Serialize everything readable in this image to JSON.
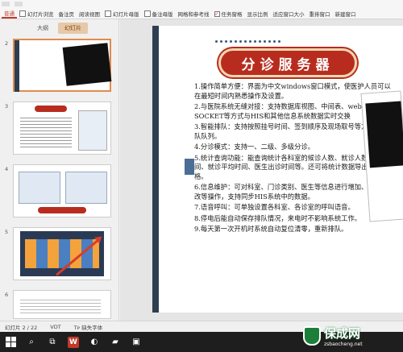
{
  "ribbon": {
    "items": [
      "普通",
      "幻灯片浏览",
      "备注页",
      "阅读视图",
      "幻灯片母版",
      "备注母版",
      "网格和参考线",
      "任务窗格",
      "显示比例",
      "适应窗口大小",
      "重排窗口",
      "新建窗口"
    ],
    "active": "普通",
    "task_pane_checked": "✓"
  },
  "left_panel": {
    "tabs": [
      "大纲",
      "幻灯片"
    ],
    "active_tab": "幻灯片",
    "slide_numbers": [
      "2",
      "3",
      "4",
      "5",
      "6"
    ]
  },
  "slide": {
    "title": "分诊服务器",
    "points": [
      "1.操作简单方便：界面为中文windows窗口模式，使医护人员可以在最短时间内熟悉操作及设置。",
      "2.与医院系统无缝对接：支持数据库视图、中间表、web service、SOCKET等方式与HIS和其他信息系统数据实时交换",
      "3.智能排队：支持按照挂号时间、签到顺序及现场取号等方式生成排队队列。",
      "4.分诊模式：支持一、二级、多级分诊。",
      "5.统计查询功能：能查询统计各科室的候诊人数、就诊人数、候诊时间、就诊平均时间、医生出诊时间等。还可将统计数据导出为.xlsx表格。",
      "6.信息维护：可对科室、门诊类别、医生等信息进行增加、删除、修改等操作，支持同步HIS系统中的数据。",
      "7.语音呼叫：可单独设置各科室、各诊室的呼叫语音。",
      "8.停电后能自动保存排队情况，来电时不影响系统工作。",
      "9.每天第一次开机时系统自动复位清零，重新排队。"
    ]
  },
  "status_bar": {
    "slide_info": "幻灯片 2 / 22",
    "theme": "VDT",
    "missing_font": "缺失字体"
  },
  "watermark": {
    "title": "保成网",
    "url": "zsbaocheng.net"
  }
}
